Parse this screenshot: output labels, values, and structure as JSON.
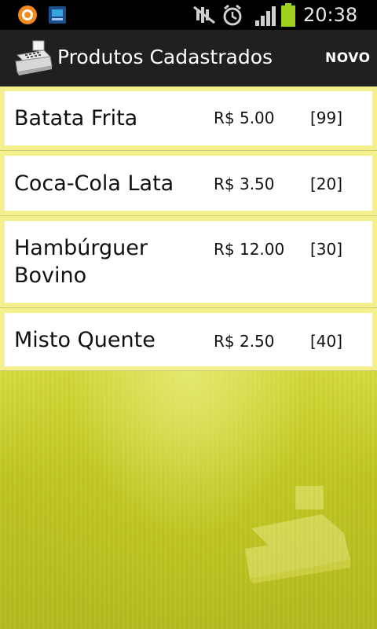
{
  "status_bar": {
    "time": "20:38",
    "icons": [
      "app-circle-icon",
      "app-book-icon",
      "mute-icon",
      "alarm-icon",
      "signal-icon",
      "battery-icon"
    ]
  },
  "action_bar": {
    "title": "Produtos Cadastrados",
    "action_label": "NOVO",
    "logo_icon": "cash-register-icon"
  },
  "products": [
    {
      "name": "Batata Frita",
      "price": "R$ 5.00",
      "qty": "[99]"
    },
    {
      "name": "Coca-Cola Lata",
      "price": "R$ 3.50",
      "qty": "[20]"
    },
    {
      "name": "Hambúrguer Bovino",
      "price": "R$ 12.00",
      "qty": "[30]"
    },
    {
      "name": "Misto Quente",
      "price": "R$ 2.50",
      "qty": "[40]"
    }
  ],
  "colors": {
    "status_bar_bg": "#000000",
    "action_bar_bg": "#202020",
    "row_border": "#f3f08d",
    "background": "#bcc31f",
    "battery": "#9ed11e"
  }
}
